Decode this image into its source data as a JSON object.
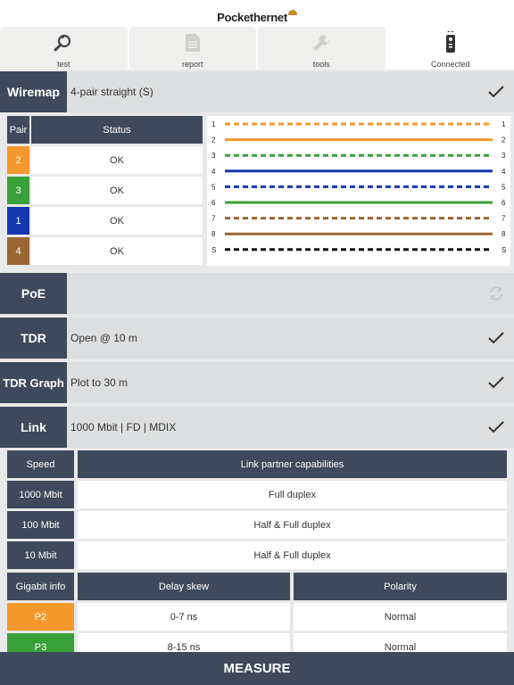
{
  "app": {
    "logo_text": "Pockethernet"
  },
  "tabs": [
    {
      "label": "test",
      "icon": "magnifier-icon"
    },
    {
      "label": "report",
      "icon": "document-icon"
    },
    {
      "label": "tools",
      "icon": "wrench-icon"
    },
    {
      "label": "Connected",
      "icon": "remote-device-icon"
    }
  ],
  "wiremap": {
    "title": "Wiremap",
    "value": "4-pair straight (S)",
    "status": "check-icon",
    "table": {
      "header_pair": "Pair",
      "header_status": "Status",
      "rows": [
        {
          "pair": "2",
          "status": "OK",
          "color": "#f7982f"
        },
        {
          "pair": "3",
          "status": "OK",
          "color": "#3aa03a"
        },
        {
          "pair": "1",
          "status": "OK",
          "color": "#1438b0"
        },
        {
          "pair": "4",
          "status": "OK",
          "color": "#9a6530"
        }
      ]
    },
    "wires": [
      {
        "left": "1",
        "right": "1",
        "color": "#f7982f",
        "dashed": true
      },
      {
        "left": "2",
        "right": "2",
        "color": "#f7982f",
        "dashed": false
      },
      {
        "left": "3",
        "right": "3",
        "color": "#3aa03a",
        "dashed": true
      },
      {
        "left": "4",
        "right": "4",
        "color": "#1438b0",
        "dashed": false
      },
      {
        "left": "5",
        "right": "5",
        "color": "#1438b0",
        "dashed": true
      },
      {
        "left": "6",
        "right": "6",
        "color": "#3aa03a",
        "dashed": false
      },
      {
        "left": "7",
        "right": "7",
        "color": "#9a6530",
        "dashed": true
      },
      {
        "left": "8",
        "right": "8",
        "color": "#9a6530",
        "dashed": false
      },
      {
        "left": "S",
        "right": "S",
        "color": "#111111",
        "dashed": true
      }
    ]
  },
  "poe": {
    "title": "PoE",
    "value": "",
    "status": "refresh-icon"
  },
  "tdr": {
    "title": "TDR",
    "value": "Open @ 10 m",
    "status": "check-icon"
  },
  "tdr_graph": {
    "title": "TDR Graph",
    "value": "Plot to 30 m",
    "status": "check-icon"
  },
  "link": {
    "title": "Link",
    "value": "1000 Mbit | FD | MDIX",
    "status": "check-icon",
    "speed_header": "Speed",
    "capabilities_header": "Link partner capabilities",
    "speeds": [
      {
        "speed": "1000 Mbit",
        "capability": "Full duplex"
      },
      {
        "speed": "100 Mbit",
        "capability": "Half & Full duplex"
      },
      {
        "speed": "10 Mbit",
        "capability": "Half & Full duplex"
      }
    ],
    "gigabit_header": "Gigabit info",
    "delay_header": "Delay skew",
    "polarity_header": "Polarity",
    "gigabit_rows": [
      {
        "pair": "P2",
        "delay": "0-7 ns",
        "polarity": "Normal",
        "color": "#f7982f"
      },
      {
        "pair": "P3",
        "delay": "8-15 ns",
        "polarity": "Normal",
        "color": "#3aa03a"
      }
    ]
  },
  "measure_label": "MEASURE",
  "colors": {
    "dark": "#3e4a5c",
    "panel": "#dcdedf",
    "background": "#e8e9ea"
  }
}
